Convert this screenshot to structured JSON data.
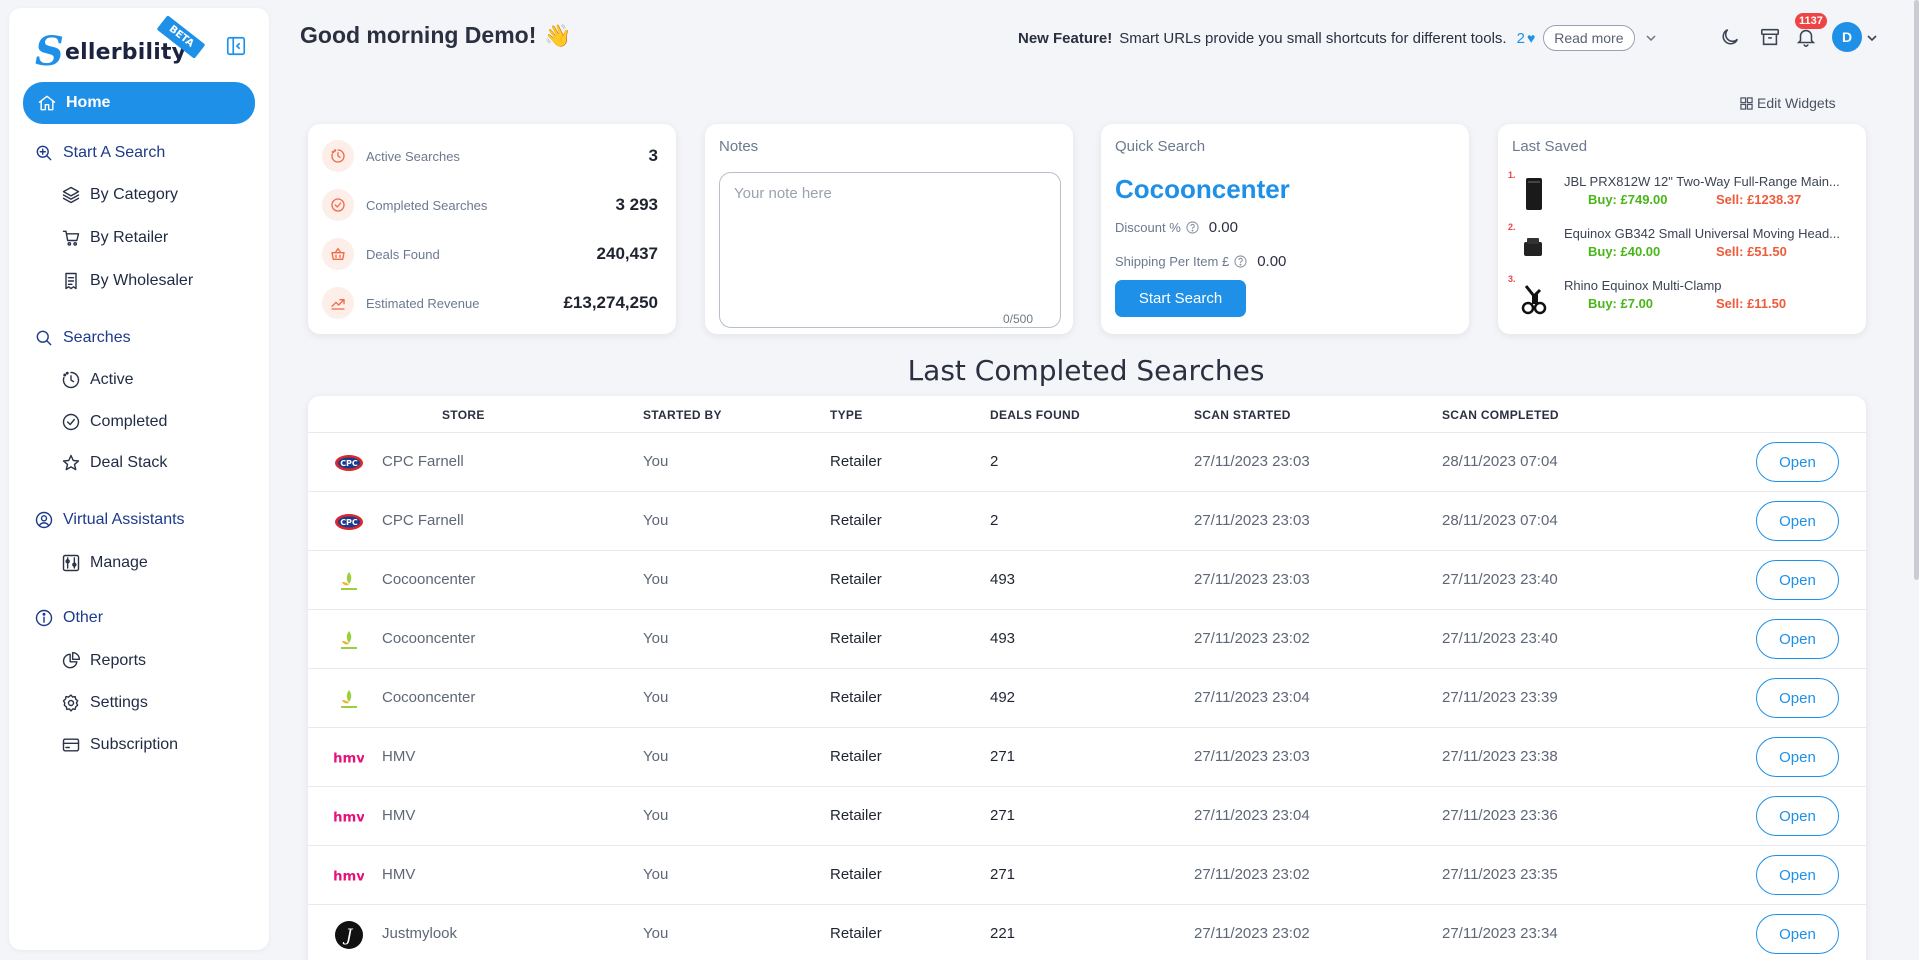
{
  "brand": {
    "name": "ellerbility",
    "initial": "S",
    "badge": "BETA",
    "accent": "#1e90e8"
  },
  "sidebar": {
    "items": [
      {
        "label": "Home",
        "icon": "home-icon",
        "active": true
      },
      {
        "label": "Start A Search",
        "icon": "search-plus-icon",
        "section": true
      },
      {
        "label": "By Category",
        "icon": "layers-icon"
      },
      {
        "label": "By Retailer",
        "icon": "cart-icon"
      },
      {
        "label": "By Wholesaler",
        "icon": "receipt-icon"
      },
      {
        "label": "Searches",
        "icon": "search-icon",
        "section": true
      },
      {
        "label": "Active",
        "icon": "timer-icon"
      },
      {
        "label": "Completed",
        "icon": "check-circle-icon"
      },
      {
        "label": "Deal Stack",
        "icon": "star-icon"
      },
      {
        "label": "Virtual Assistants",
        "icon": "user-circle-icon",
        "section": true
      },
      {
        "label": "Manage",
        "icon": "sliders-icon"
      },
      {
        "label": "Other",
        "icon": "info-icon",
        "section": true
      },
      {
        "label": "Reports",
        "icon": "pie-chart-icon"
      },
      {
        "label": "Settings",
        "icon": "gear-icon"
      },
      {
        "label": "Subscription",
        "icon": "card-icon"
      }
    ]
  },
  "header": {
    "greeting": "Good morning Demo!",
    "wave": "👋",
    "feature_title": "New Feature!",
    "feature_text": "Smart URLs provide you small shortcuts for different tools.",
    "feature_likes": "2",
    "read_more": "Read more",
    "notification_count": "1137",
    "avatar_initial": "D"
  },
  "edit_widgets": "Edit Widgets",
  "stats": [
    {
      "label": "Active Searches",
      "value": "3",
      "icon": "timer-icon"
    },
    {
      "label": "Completed Searches",
      "value": "3 293",
      "icon": "check-circle-icon"
    },
    {
      "label": "Deals Found",
      "value": "240,437",
      "icon": "basket-icon"
    },
    {
      "label": "Estimated Revenue",
      "value": "£13,274,250",
      "icon": "trend-up-icon"
    }
  ],
  "notes": {
    "title": "Notes",
    "placeholder": "Your note here",
    "value": "",
    "counter": "0/500"
  },
  "quick_search": {
    "title": "Quick Search",
    "store": "Cocooncenter",
    "discount_label": "Discount %",
    "discount_value": "0.00",
    "shipping_label": "Shipping Per Item £",
    "shipping_value": "0.00",
    "button": "Start Search"
  },
  "last_saved": {
    "title": "Last Saved",
    "items": [
      {
        "num": "1.",
        "name": "JBL PRX812W 12\" Two-Way Full-Range Main...",
        "buy": "Buy: £749.00",
        "sell": "Sell: £1238.37"
      },
      {
        "num": "2.",
        "name": "Equinox GB342 Small Universal Moving Head...",
        "buy": "Buy: £40.00",
        "sell": "Sell: £51.50"
      },
      {
        "num": "3.",
        "name": "Rhino Equinox Multi-Clamp",
        "buy": "Buy: £7.00",
        "sell": "Sell: £11.50"
      }
    ]
  },
  "table": {
    "title": "Last Completed Searches",
    "columns": [
      "STORE",
      "STARTED BY",
      "TYPE",
      "DEALS FOUND",
      "SCAN STARTED",
      "SCAN COMPLETED"
    ],
    "open_label": "Open",
    "rows": [
      {
        "store": "CPC Farnell",
        "logo": "cpc",
        "started_by": "You",
        "type": "Retailer",
        "deals": "2",
        "started": "27/11/2023 23:03",
        "completed": "28/11/2023 07:04"
      },
      {
        "store": "CPC Farnell",
        "logo": "cpc",
        "started_by": "You",
        "type": "Retailer",
        "deals": "2",
        "started": "27/11/2023 23:03",
        "completed": "28/11/2023 07:04"
      },
      {
        "store": "Cocooncenter",
        "logo": "cocoon",
        "started_by": "You",
        "type": "Retailer",
        "deals": "493",
        "started": "27/11/2023 23:03",
        "completed": "27/11/2023 23:40"
      },
      {
        "store": "Cocooncenter",
        "logo": "cocoon",
        "started_by": "You",
        "type": "Retailer",
        "deals": "493",
        "started": "27/11/2023 23:02",
        "completed": "27/11/2023 23:40"
      },
      {
        "store": "Cocooncenter",
        "logo": "cocoon",
        "started_by": "You",
        "type": "Retailer",
        "deals": "492",
        "started": "27/11/2023 23:04",
        "completed": "27/11/2023 23:39"
      },
      {
        "store": "HMV",
        "logo": "hmv",
        "started_by": "You",
        "type": "Retailer",
        "deals": "271",
        "started": "27/11/2023 23:03",
        "completed": "27/11/2023 23:38"
      },
      {
        "store": "HMV",
        "logo": "hmv",
        "started_by": "You",
        "type": "Retailer",
        "deals": "271",
        "started": "27/11/2023 23:04",
        "completed": "27/11/2023 23:36"
      },
      {
        "store": "HMV",
        "logo": "hmv",
        "started_by": "You",
        "type": "Retailer",
        "deals": "271",
        "started": "27/11/2023 23:02",
        "completed": "27/11/2023 23:35"
      },
      {
        "store": "Justmylook",
        "logo": "jml",
        "started_by": "You",
        "type": "Retailer",
        "deals": "221",
        "started": "27/11/2023 23:02",
        "completed": "27/11/2023 23:34"
      }
    ]
  }
}
